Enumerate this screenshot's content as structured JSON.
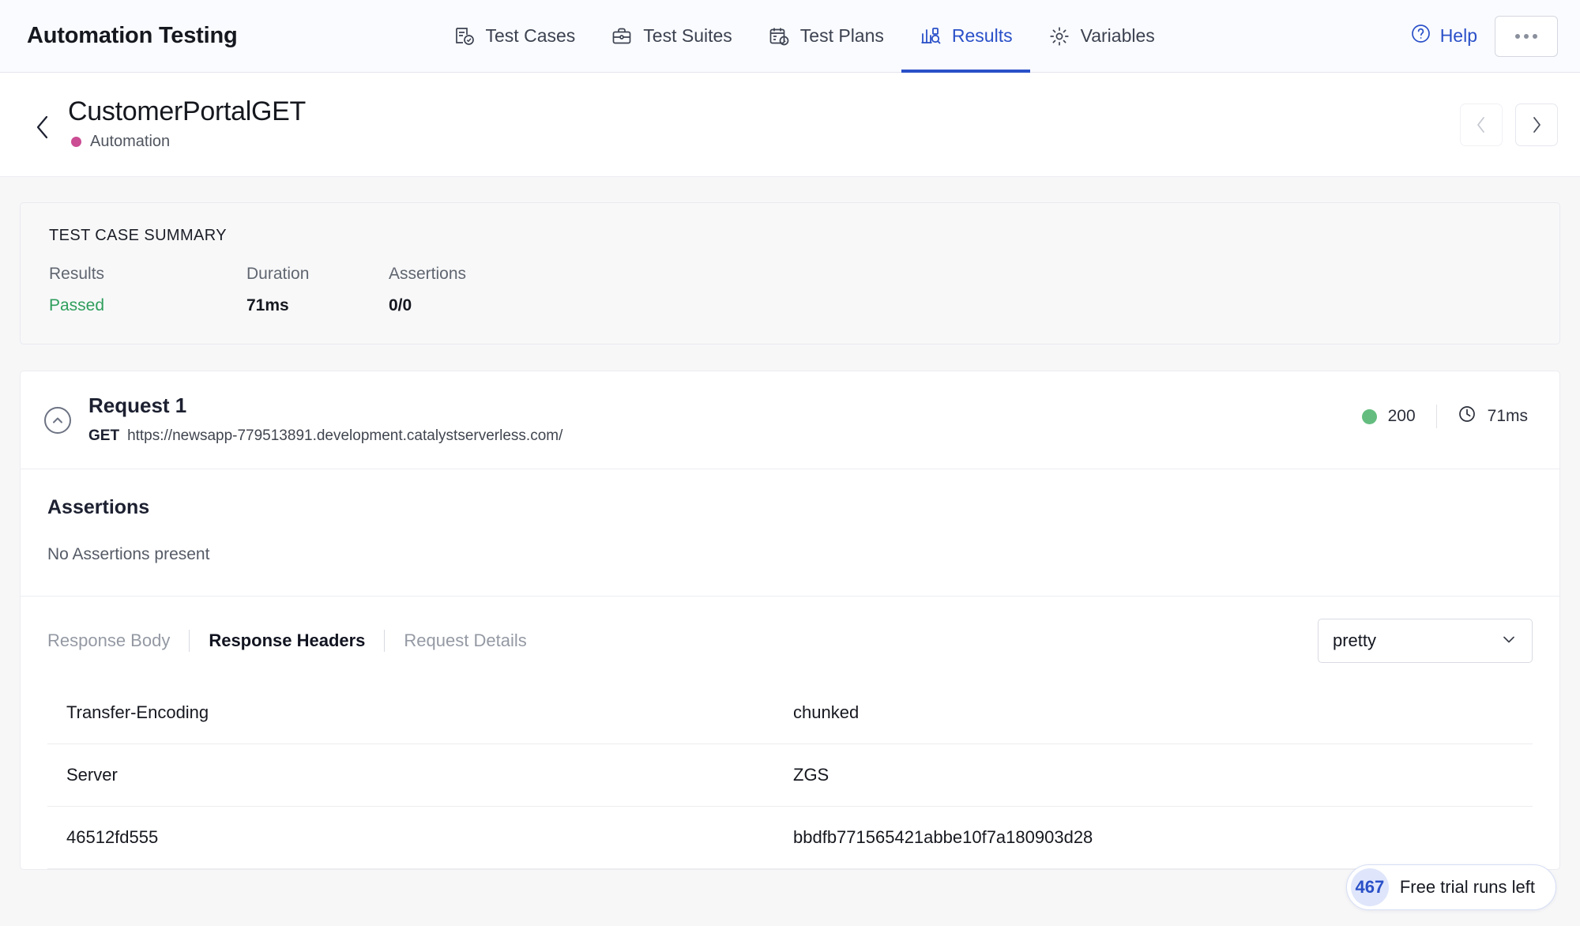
{
  "topbar": {
    "brand": "Automation Testing",
    "tabs": [
      {
        "label": "Test Cases",
        "icon": "test-cases-icon",
        "active": false
      },
      {
        "label": "Test Suites",
        "icon": "briefcase-icon",
        "active": false
      },
      {
        "label": "Test Plans",
        "icon": "calendar-clock-icon",
        "active": false
      },
      {
        "label": "Results",
        "icon": "bar-chart-search-icon",
        "active": true
      },
      {
        "label": "Variables",
        "icon": "gear-icon",
        "active": false
      }
    ],
    "help_label": "Help",
    "help_icon": "question-circle-icon",
    "more_icon": "ellipsis-icon",
    "accent_color": "#2a50c8"
  },
  "page_header": {
    "back_icon": "chevron-left-icon",
    "title": "CustomerPortalGET",
    "tag_label": "Automation",
    "tag_color": "#cb4d93",
    "prev_icon": "chevron-left-icon",
    "next_icon": "chevron-right-icon"
  },
  "summary": {
    "heading": "TEST CASE SUMMARY",
    "fields": [
      {
        "key": "Results",
        "value": "Passed",
        "status_color": "#2f9e5c"
      },
      {
        "key": "Duration",
        "value": "71ms"
      },
      {
        "key": "Assertions",
        "value": "0/0"
      }
    ]
  },
  "request": {
    "collapse_icon": "chevron-up-circle-icon",
    "title": "Request 1",
    "method": "GET",
    "url": "https://newsapp-779513891.development.catalystserverless.com/",
    "status_code": "200",
    "status_color": "#64bd7f",
    "duration": "71ms",
    "clock_icon": "clock-icon"
  },
  "assertions": {
    "heading": "Assertions",
    "empty_text": "No Assertions present"
  },
  "response": {
    "tabs": [
      {
        "label": "Response Body",
        "active": false
      },
      {
        "label": "Response Headers",
        "active": true
      },
      {
        "label": "Request Details",
        "active": false
      }
    ],
    "format_select": {
      "value": "pretty",
      "chevron_icon": "chevron-down-icon"
    },
    "headers": [
      {
        "key": "Transfer-Encoding",
        "value": "chunked"
      },
      {
        "key": "Server",
        "value": "ZGS"
      },
      {
        "key": "46512fd555",
        "value": "bbdfb771565421abbe10f7a180903d28"
      }
    ]
  },
  "trial": {
    "count": "467",
    "text": "Free trial runs left",
    "count_color": "#2a50c8"
  }
}
